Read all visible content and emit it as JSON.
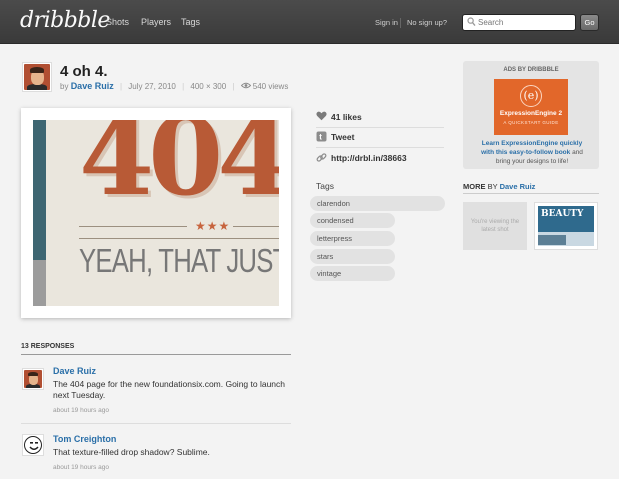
{
  "header": {
    "logo": "dribbble",
    "nav": [
      "Shots",
      "Players",
      "Tags"
    ],
    "signin": "Sign in",
    "nosignup": "No sign up?",
    "search_placeholder": "Search",
    "go_label": "Go"
  },
  "shot": {
    "title": "4 oh 4.",
    "by": "by",
    "author": "Dave Ruiz",
    "date": "July 27, 2010",
    "dimensions": "400 × 300",
    "views": "540 views",
    "art": {
      "big_text": "404",
      "stars": "★★★",
      "tagline": "YEAH, THAT JUST HAP"
    }
  },
  "actions": {
    "likes": "41 likes",
    "tweet": "Tweet",
    "link": "http://drbl.in/38663"
  },
  "tags": {
    "heading": "Tags",
    "items": [
      "clarendon",
      "condensed",
      "letterpress",
      "stars",
      "vintage"
    ]
  },
  "ads": {
    "heading": "ADS BY DRIBBBLE",
    "banner_logo": "(e)",
    "banner_name": "ExpressionEngine 2",
    "banner_sub": "A QUICKSTART GUIDE",
    "link_text": "Learn ExpressionEngine quickly with this easy-to-follow book",
    "rest_text": "and bring your designs to life!"
  },
  "more": {
    "label": "MORE",
    "by": "BY",
    "author": "Dave Ruiz",
    "current_text": "You're viewing the latest shot",
    "next_thumb_text": "BEAUTY"
  },
  "responses": {
    "heading": "13 RESPONSES",
    "items": [
      {
        "author": "Dave Ruiz",
        "text": "The 404 page for the new foundationsix.com. Going to launch next Tuesday.",
        "time": "about 19 hours ago"
      },
      {
        "author": "Tom Creighton",
        "text": "That texture-filled drop shadow? Sublime.",
        "time": "about 19 hours ago"
      }
    ]
  }
}
